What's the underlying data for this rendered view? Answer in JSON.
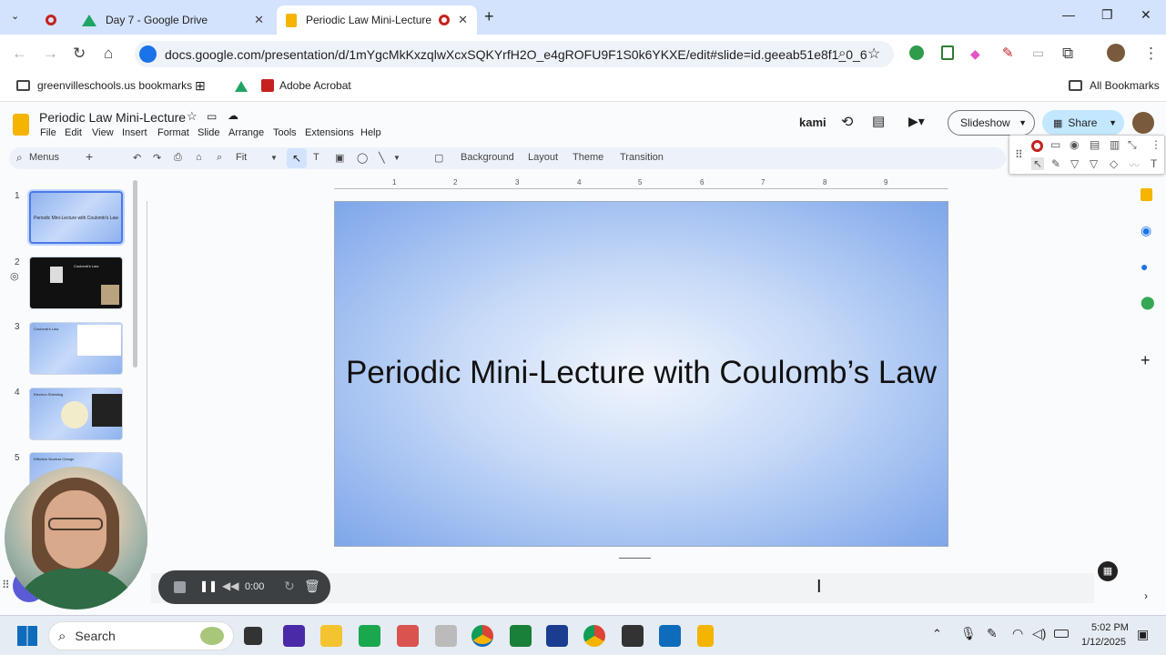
{
  "browser": {
    "tabs": [
      {
        "title": "",
        "icon": "record-icon"
      },
      {
        "title": "Day 7 - Google Drive",
        "icon": "google-drive-icon"
      },
      {
        "title": "Periodic Law Mini-Lecture -",
        "icon": "google-slides-icon",
        "active": true
      }
    ],
    "url": "docs.google.com/presentation/d/1mYgcMkKxzqlwXcxSQKYrfH2O_e4gROFU9F1S0k6YKXE/edit#slide=id.geeab51e8f1_0_6",
    "bookmarks": [
      "greenvilleschools.us bookmarks",
      "Adobe Acrobat"
    ],
    "all_bookmarks": "All Bookmarks"
  },
  "app": {
    "doc_title": "Periodic Law Mini-Lecture",
    "menus": [
      "File",
      "Edit",
      "View",
      "Insert",
      "Format",
      "Slide",
      "Arrange",
      "Tools",
      "Extensions",
      "Help"
    ],
    "kami_label": "kami",
    "slideshow_label": "Slideshow",
    "share_label": "Share",
    "toolbar": {
      "menus_label": "Menus",
      "zoom_label": "Fit",
      "background_label": "Background",
      "layout_label": "Layout",
      "theme_label": "Theme",
      "transition_label": "Transition"
    }
  },
  "filmstrip": {
    "slides": [
      {
        "number": "1",
        "caption": "Periodic Mini-Lecture with Coulomb's Law"
      },
      {
        "number": "2",
        "caption": "Coulomb's Law"
      },
      {
        "number": "3",
        "caption": "Coulomb's Law"
      },
      {
        "number": "4",
        "caption": "Electron Shielding"
      },
      {
        "number": "5",
        "caption": "Effective Nuclear Charge"
      }
    ]
  },
  "ruler_ticks": [
    "1",
    "2",
    "3",
    "4",
    "5",
    "6",
    "7",
    "8",
    "9"
  ],
  "slide": {
    "title": "Periodic Mini-Lecture with Coulomb’s Law"
  },
  "recorder": {
    "time": "0:00"
  },
  "taskbar": {
    "search_label": "Search",
    "time": "5:02 PM",
    "date": "1/12/2025"
  }
}
